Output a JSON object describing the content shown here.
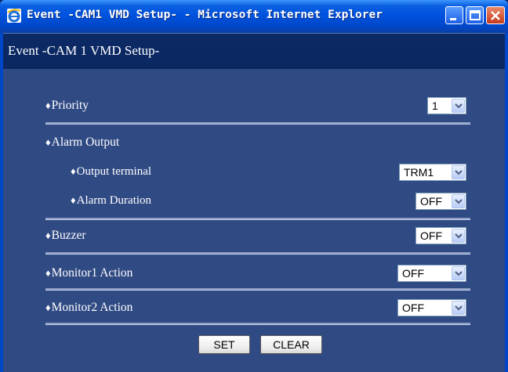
{
  "window": {
    "title": "Event -CAM1 VMD Setup- - Microsoft Internet Explorer"
  },
  "page": {
    "title": "Event -CAM 1  VMD Setup-"
  },
  "bullet": "♦",
  "fields": {
    "priority": {
      "label": "Priority",
      "value": "1"
    },
    "alarm_output": {
      "label": "Alarm Output"
    },
    "output_terminal": {
      "label": "Output terminal",
      "value": "TRM1"
    },
    "alarm_duration": {
      "label": "Alarm Duration",
      "value": "OFF"
    },
    "buzzer": {
      "label": "Buzzer",
      "value": "OFF"
    },
    "monitor1_action": {
      "label": "Monitor1 Action",
      "value": "OFF"
    },
    "monitor2_action": {
      "label": "Monitor2 Action",
      "value": "OFF"
    }
  },
  "buttons": {
    "set": "SET",
    "clear": "CLEAR"
  },
  "colors": {
    "titlebar": "#0053e0",
    "header": "#0a2760",
    "content": "#304a84"
  }
}
